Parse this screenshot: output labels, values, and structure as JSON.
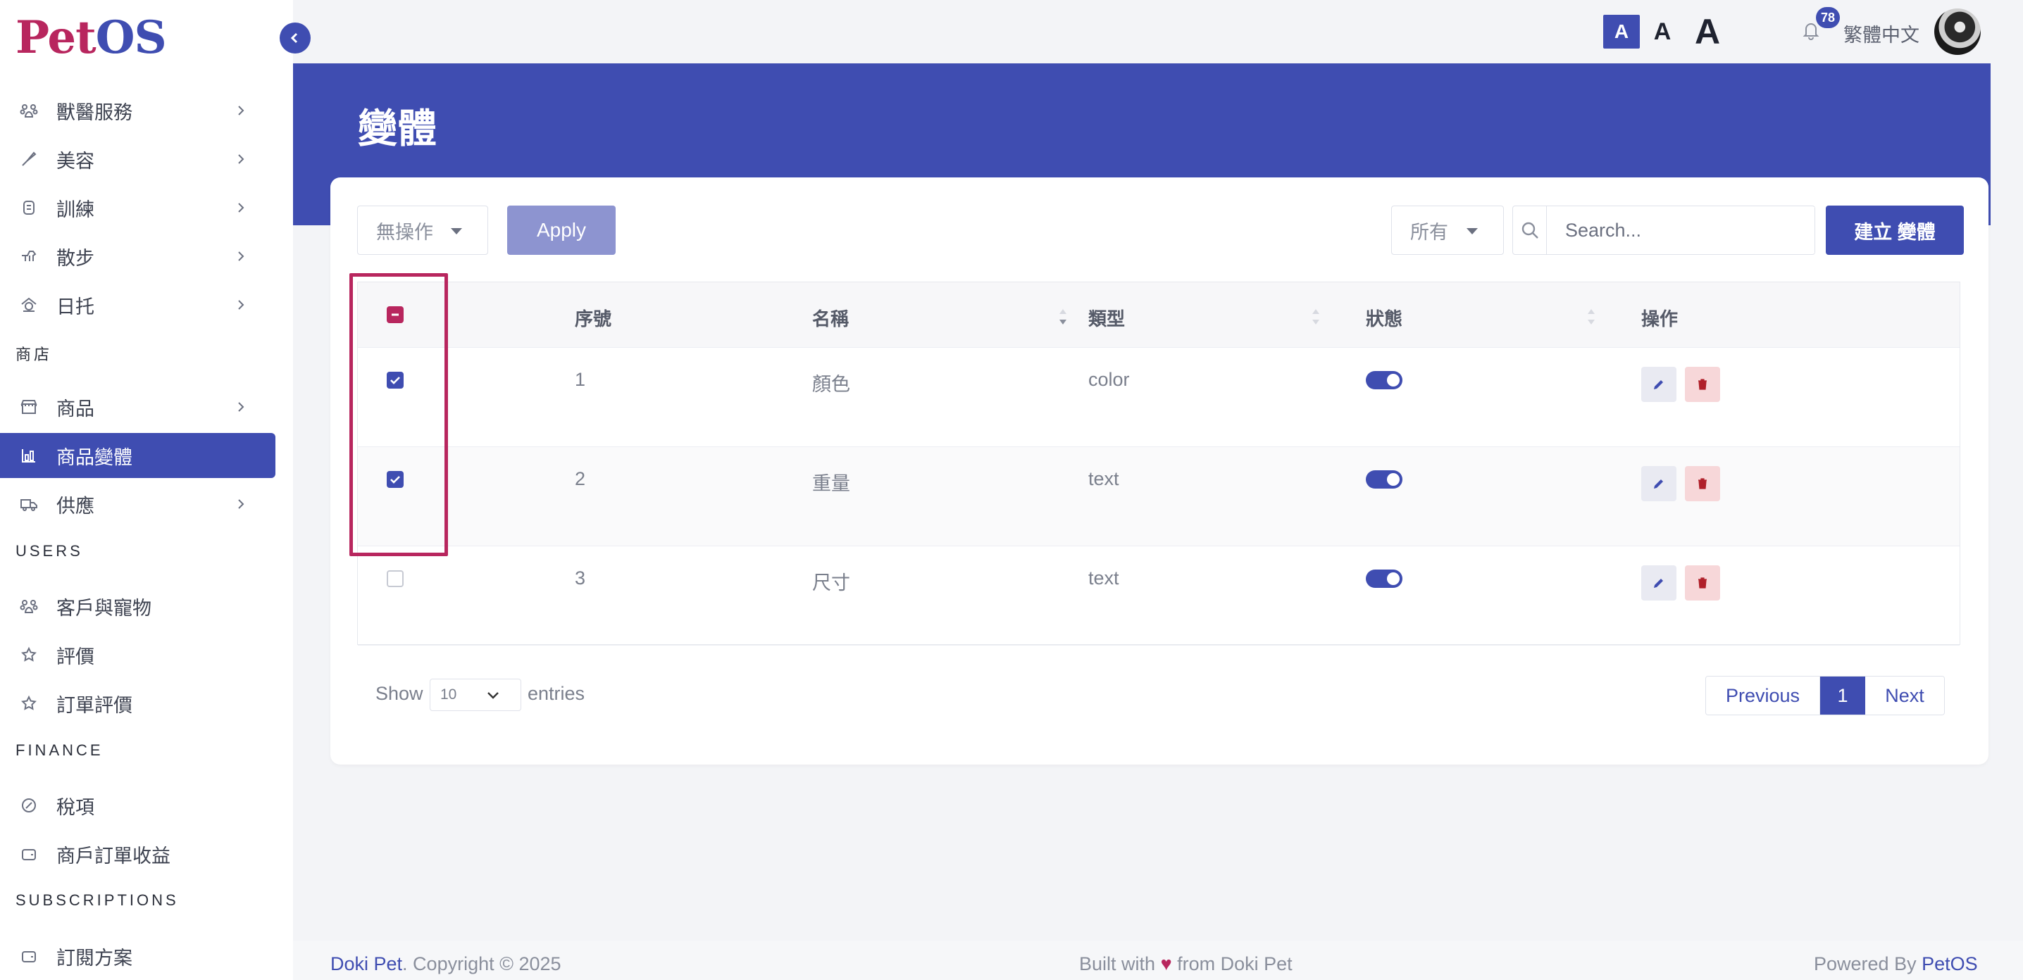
{
  "brand": {
    "logo_part1": "Pet",
    "logo_part2": "OS"
  },
  "sidebar": {
    "items": [
      {
        "label": "獸醫服務",
        "icon": "paw-icon"
      },
      {
        "label": "美容",
        "icon": "scissors-icon"
      },
      {
        "label": "訓練",
        "icon": "training-icon"
      },
      {
        "label": "散步",
        "icon": "dog-walk-icon"
      },
      {
        "label": "日托",
        "icon": "daycare-icon"
      }
    ],
    "section_shop": "商店",
    "shop_items": [
      {
        "label": "商品",
        "icon": "store-icon"
      },
      {
        "label": "商品變體",
        "icon": "variants-icon"
      },
      {
        "label": "供應",
        "icon": "truck-icon"
      }
    ],
    "section_users": "USERS",
    "user_items": [
      {
        "label": "客戶與寵物",
        "icon": "paw-icon"
      },
      {
        "label": "評價",
        "icon": "star-icon"
      },
      {
        "label": "訂單評價",
        "icon": "star-icon"
      }
    ],
    "section_finance": "FINANCE",
    "finance_items": [
      {
        "label": "稅項",
        "icon": "tax-icon"
      },
      {
        "label": "商戶訂單收益",
        "icon": "wallet-icon"
      }
    ],
    "section_subscriptions": "SUBSCRIPTIONS",
    "subscription_items": [
      {
        "label": "訂閱方案",
        "icon": "wallet-icon"
      }
    ]
  },
  "topbar": {
    "font_small": "A",
    "font_medium": "A",
    "font_large": "A",
    "notification_count": "78",
    "language": "繁體中文"
  },
  "page": {
    "title": "變體"
  },
  "toolbar": {
    "bulk_action": "無操作",
    "apply_label": "Apply",
    "filter_value": "所有",
    "search_placeholder": "Search...",
    "create_label": "建立 變體"
  },
  "table": {
    "headers": {
      "index": "序號",
      "name": "名稱",
      "type": "類型",
      "status": "狀態",
      "actions": "操作"
    },
    "rows": [
      {
        "index": "1",
        "name": "顏色",
        "type": "color",
        "checked": true,
        "status_on": true
      },
      {
        "index": "2",
        "name": "重量",
        "type": "text",
        "checked": true,
        "status_on": true
      },
      {
        "index": "3",
        "name": "尺寸",
        "type": "text",
        "checked": false,
        "status_on": true
      }
    ]
  },
  "footer_controls": {
    "show_label": "Show",
    "entries_value": "10",
    "entries_label": "entries",
    "prev_label": "Previous",
    "page_number": "1",
    "next_label": "Next"
  },
  "page_footer": {
    "company": "Doki Pet",
    "copyright": ". Copyright © 2025",
    "built_prefix": "Built with",
    "heart": "♥",
    "built_suffix": "from Doki Pet",
    "powered_prefix": "Powered By",
    "powered_brand": "PetOS"
  },
  "colors": {
    "primary": "#3f4db1",
    "accent": "#b8265e",
    "delete_bg": "#f7d7d9"
  }
}
